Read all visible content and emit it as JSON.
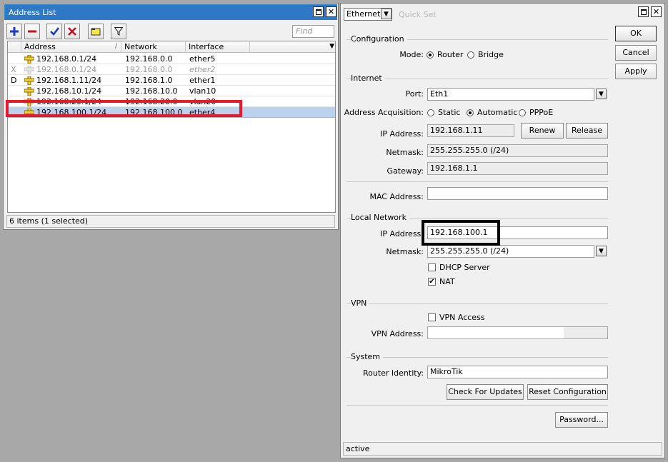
{
  "address_list": {
    "title": "Address List",
    "find_placeholder": "Find",
    "columns": [
      "Address",
      "Network",
      "Interface"
    ],
    "sort_indicator": "/",
    "rows": [
      {
        "flag": "",
        "address": "192.168.0.1/24",
        "network": "192.168.0.0",
        "interface": "ether5",
        "state": "normal"
      },
      {
        "flag": "X",
        "address": "192.168.0.1/24",
        "network": "192.168.0.0",
        "interface": "ether2",
        "state": "disabled"
      },
      {
        "flag": "D",
        "address": "192.168.1.11/24",
        "network": "192.168.1.0",
        "interface": "ether1",
        "state": "normal"
      },
      {
        "flag": "",
        "address": "192.168.10.1/24",
        "network": "192.168.10.0",
        "interface": "vlan10",
        "state": "normal"
      },
      {
        "flag": "",
        "address": "192.168.20.1/24",
        "network": "192.168.20.0",
        "interface": "vlan20",
        "state": "normal"
      },
      {
        "flag": "",
        "address": "192.168.100.1/24",
        "network": "192.168.100.0",
        "interface": "ether4",
        "state": "selected"
      }
    ],
    "status": "6 items (1 selected)",
    "toolbar_icons": [
      "add-icon",
      "remove-icon",
      "enable-icon",
      "disable-icon",
      "comment-icon",
      "filter-icon"
    ]
  },
  "quick_set": {
    "mode": "Ethernet",
    "title": "Quick Set",
    "buttons": {
      "ok": "OK",
      "cancel": "Cancel",
      "apply": "Apply"
    },
    "configuration": {
      "title": "Configuration",
      "mode_label": "Mode:",
      "router": "Router",
      "bridge": "Bridge",
      "selected": "Router"
    },
    "internet": {
      "title": "Internet",
      "port_label": "Port:",
      "port_value": "Eth1",
      "acq_label": "Address Acquisition:",
      "acq_static": "Static",
      "acq_automatic": "Automatic",
      "acq_pppoe": "PPPoE",
      "acq_selected": "Automatic",
      "ip_label": "IP Address:",
      "ip_value": "192.168.1.11",
      "renew": "Renew",
      "release": "Release",
      "netmask_label": "Netmask:",
      "netmask_value": "255.255.255.0 (/24)",
      "gateway_label": "Gateway:",
      "gateway_value": "192.168.1.1",
      "mac_label": "MAC Address:",
      "mac_value": ""
    },
    "local": {
      "title": "Local Network",
      "ip_label": "IP Address:",
      "ip_value": "192.168.100.1",
      "netmask_label": "Netmask:",
      "netmask_value": "255.255.255.0 (/24)",
      "dhcp_label": "DHCP Server",
      "dhcp_checked": false,
      "nat_label": "NAT",
      "nat_checked": true
    },
    "vpn": {
      "title": "VPN",
      "access_label": "VPN Access",
      "access_checked": false,
      "address_label": "VPN Address:",
      "address_value": ""
    },
    "system": {
      "title": "System",
      "identity_label": "Router Identity:",
      "identity_value": "MikroTik",
      "check_updates": "Check For Updates",
      "reset": "Reset Configuration",
      "password": "Password..."
    },
    "status": "active"
  },
  "colors": {
    "title_blue": "#2d79c8",
    "selection": "#bcd2ec",
    "red_highlight": "#e8192c",
    "black_highlight": "#000000"
  }
}
